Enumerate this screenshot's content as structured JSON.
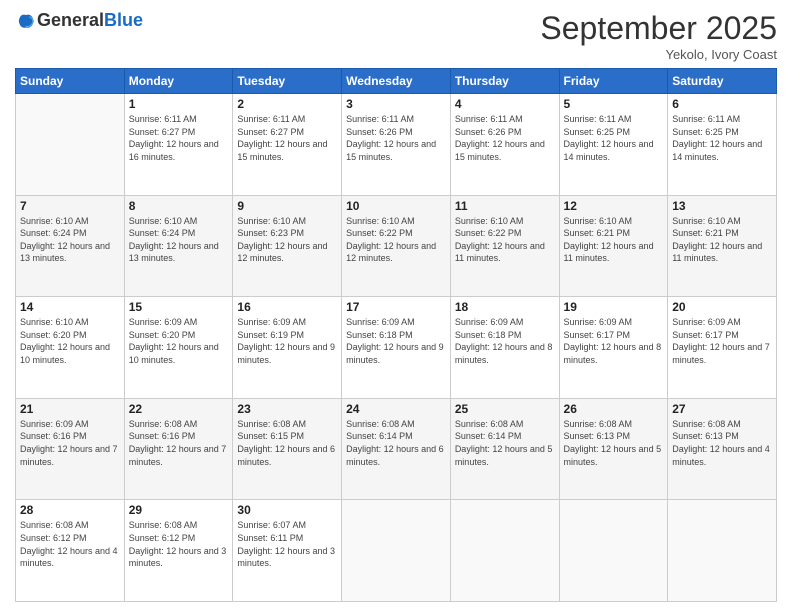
{
  "header": {
    "logo_general": "General",
    "logo_blue": "Blue",
    "month_title": "September 2025",
    "location": "Yekolo, Ivory Coast"
  },
  "days_of_week": [
    "Sunday",
    "Monday",
    "Tuesday",
    "Wednesday",
    "Thursday",
    "Friday",
    "Saturday"
  ],
  "weeks": [
    {
      "shade": "row-white",
      "days": [
        {
          "date": "",
          "sunrise": "",
          "sunset": "",
          "daylight": ""
        },
        {
          "date": "1",
          "sunrise": "Sunrise: 6:11 AM",
          "sunset": "Sunset: 6:27 PM",
          "daylight": "Daylight: 12 hours and 16 minutes."
        },
        {
          "date": "2",
          "sunrise": "Sunrise: 6:11 AM",
          "sunset": "Sunset: 6:27 PM",
          "daylight": "Daylight: 12 hours and 15 minutes."
        },
        {
          "date": "3",
          "sunrise": "Sunrise: 6:11 AM",
          "sunset": "Sunset: 6:26 PM",
          "daylight": "Daylight: 12 hours and 15 minutes."
        },
        {
          "date": "4",
          "sunrise": "Sunrise: 6:11 AM",
          "sunset": "Sunset: 6:26 PM",
          "daylight": "Daylight: 12 hours and 15 minutes."
        },
        {
          "date": "5",
          "sunrise": "Sunrise: 6:11 AM",
          "sunset": "Sunset: 6:25 PM",
          "daylight": "Daylight: 12 hours and 14 minutes."
        },
        {
          "date": "6",
          "sunrise": "Sunrise: 6:11 AM",
          "sunset": "Sunset: 6:25 PM",
          "daylight": "Daylight: 12 hours and 14 minutes."
        }
      ]
    },
    {
      "shade": "row-shaded",
      "days": [
        {
          "date": "7",
          "sunrise": "Sunrise: 6:10 AM",
          "sunset": "Sunset: 6:24 PM",
          "daylight": "Daylight: 12 hours and 13 minutes."
        },
        {
          "date": "8",
          "sunrise": "Sunrise: 6:10 AM",
          "sunset": "Sunset: 6:24 PM",
          "daylight": "Daylight: 12 hours and 13 minutes."
        },
        {
          "date": "9",
          "sunrise": "Sunrise: 6:10 AM",
          "sunset": "Sunset: 6:23 PM",
          "daylight": "Daylight: 12 hours and 12 minutes."
        },
        {
          "date": "10",
          "sunrise": "Sunrise: 6:10 AM",
          "sunset": "Sunset: 6:22 PM",
          "daylight": "Daylight: 12 hours and 12 minutes."
        },
        {
          "date": "11",
          "sunrise": "Sunrise: 6:10 AM",
          "sunset": "Sunset: 6:22 PM",
          "daylight": "Daylight: 12 hours and 11 minutes."
        },
        {
          "date": "12",
          "sunrise": "Sunrise: 6:10 AM",
          "sunset": "Sunset: 6:21 PM",
          "daylight": "Daylight: 12 hours and 11 minutes."
        },
        {
          "date": "13",
          "sunrise": "Sunrise: 6:10 AM",
          "sunset": "Sunset: 6:21 PM",
          "daylight": "Daylight: 12 hours and 11 minutes."
        }
      ]
    },
    {
      "shade": "row-white",
      "days": [
        {
          "date": "14",
          "sunrise": "Sunrise: 6:10 AM",
          "sunset": "Sunset: 6:20 PM",
          "daylight": "Daylight: 12 hours and 10 minutes."
        },
        {
          "date": "15",
          "sunrise": "Sunrise: 6:09 AM",
          "sunset": "Sunset: 6:20 PM",
          "daylight": "Daylight: 12 hours and 10 minutes."
        },
        {
          "date": "16",
          "sunrise": "Sunrise: 6:09 AM",
          "sunset": "Sunset: 6:19 PM",
          "daylight": "Daylight: 12 hours and 9 minutes."
        },
        {
          "date": "17",
          "sunrise": "Sunrise: 6:09 AM",
          "sunset": "Sunset: 6:18 PM",
          "daylight": "Daylight: 12 hours and 9 minutes."
        },
        {
          "date": "18",
          "sunrise": "Sunrise: 6:09 AM",
          "sunset": "Sunset: 6:18 PM",
          "daylight": "Daylight: 12 hours and 8 minutes."
        },
        {
          "date": "19",
          "sunrise": "Sunrise: 6:09 AM",
          "sunset": "Sunset: 6:17 PM",
          "daylight": "Daylight: 12 hours and 8 minutes."
        },
        {
          "date": "20",
          "sunrise": "Sunrise: 6:09 AM",
          "sunset": "Sunset: 6:17 PM",
          "daylight": "Daylight: 12 hours and 7 minutes."
        }
      ]
    },
    {
      "shade": "row-shaded",
      "days": [
        {
          "date": "21",
          "sunrise": "Sunrise: 6:09 AM",
          "sunset": "Sunset: 6:16 PM",
          "daylight": "Daylight: 12 hours and 7 minutes."
        },
        {
          "date": "22",
          "sunrise": "Sunrise: 6:08 AM",
          "sunset": "Sunset: 6:16 PM",
          "daylight": "Daylight: 12 hours and 7 minutes."
        },
        {
          "date": "23",
          "sunrise": "Sunrise: 6:08 AM",
          "sunset": "Sunset: 6:15 PM",
          "daylight": "Daylight: 12 hours and 6 minutes."
        },
        {
          "date": "24",
          "sunrise": "Sunrise: 6:08 AM",
          "sunset": "Sunset: 6:14 PM",
          "daylight": "Daylight: 12 hours and 6 minutes."
        },
        {
          "date": "25",
          "sunrise": "Sunrise: 6:08 AM",
          "sunset": "Sunset: 6:14 PM",
          "daylight": "Daylight: 12 hours and 5 minutes."
        },
        {
          "date": "26",
          "sunrise": "Sunrise: 6:08 AM",
          "sunset": "Sunset: 6:13 PM",
          "daylight": "Daylight: 12 hours and 5 minutes."
        },
        {
          "date": "27",
          "sunrise": "Sunrise: 6:08 AM",
          "sunset": "Sunset: 6:13 PM",
          "daylight": "Daylight: 12 hours and 4 minutes."
        }
      ]
    },
    {
      "shade": "row-white",
      "days": [
        {
          "date": "28",
          "sunrise": "Sunrise: 6:08 AM",
          "sunset": "Sunset: 6:12 PM",
          "daylight": "Daylight: 12 hours and 4 minutes."
        },
        {
          "date": "29",
          "sunrise": "Sunrise: 6:08 AM",
          "sunset": "Sunset: 6:12 PM",
          "daylight": "Daylight: 12 hours and 3 minutes."
        },
        {
          "date": "30",
          "sunrise": "Sunrise: 6:07 AM",
          "sunset": "Sunset: 6:11 PM",
          "daylight": "Daylight: 12 hours and 3 minutes."
        },
        {
          "date": "",
          "sunrise": "",
          "sunset": "",
          "daylight": ""
        },
        {
          "date": "",
          "sunrise": "",
          "sunset": "",
          "daylight": ""
        },
        {
          "date": "",
          "sunrise": "",
          "sunset": "",
          "daylight": ""
        },
        {
          "date": "",
          "sunrise": "",
          "sunset": "",
          "daylight": ""
        }
      ]
    }
  ]
}
